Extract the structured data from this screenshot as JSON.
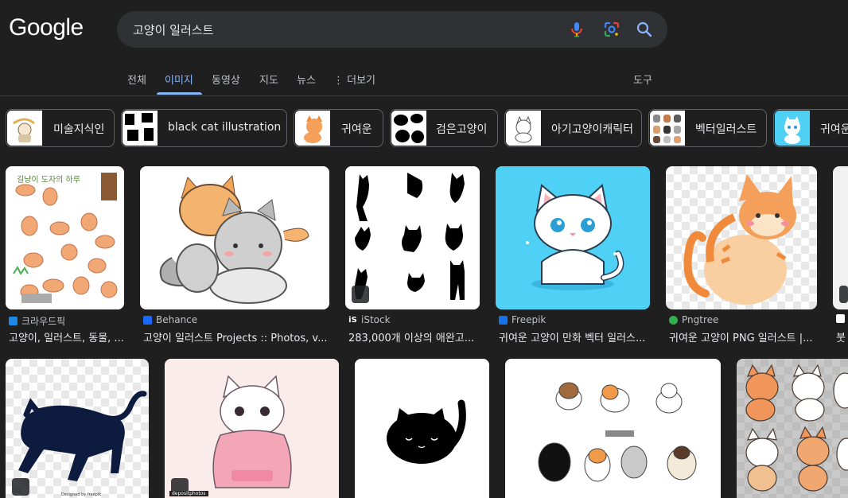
{
  "header": {
    "logo": "Google",
    "search_value": "고양이 일러스트"
  },
  "tabs": [
    {
      "label": "전체"
    },
    {
      "label": "이미지"
    },
    {
      "label": "동영상"
    },
    {
      "label": "지도"
    },
    {
      "label": "뉴스"
    },
    {
      "label": "더보기"
    },
    {
      "label": "도구"
    }
  ],
  "chips": [
    {
      "label": "미술지식인"
    },
    {
      "label": "black cat illustration"
    },
    {
      "label": "귀여운"
    },
    {
      "label": "검은고양이"
    },
    {
      "label": "아기고양이캐릭터"
    },
    {
      "label": "벡터일러스트"
    },
    {
      "label": "귀여운"
    }
  ],
  "results_row1": [
    {
      "source": "크라우드픽",
      "title": "고양이, 일러스트, 동물, ..."
    },
    {
      "source": "Behance",
      "title": "고양이 일러스트 Projects :: Photos, v..."
    },
    {
      "source": "iStock",
      "title": "283,000개 이상의 애완고..."
    },
    {
      "source": "Freepik",
      "title": "귀여운 고양이 만화 벡터 일러스..."
    },
    {
      "source": "Pngtree",
      "title": "귀여운 고양이 PNG 일러스트 |..."
    },
    {
      "source": "",
      "title": "붓"
    }
  ],
  "image_text": {
    "crowdpic_caption": "길냥이 도자의 하루",
    "freepik_watermark": "Designed by freepik",
    "depositphotos": "depositphotos"
  },
  "colors": {
    "background": "#1f1f1f",
    "search_bg": "#303134",
    "accent": "#8ab4f8",
    "freepik_bg": "#4fd0f5"
  }
}
